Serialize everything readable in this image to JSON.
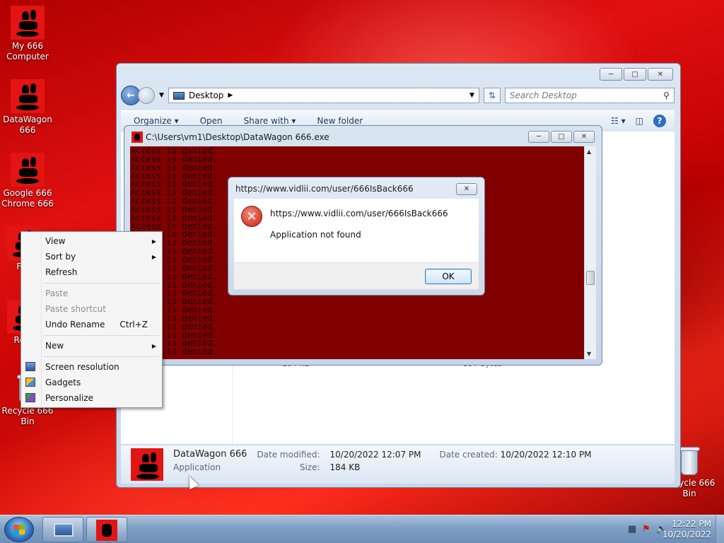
{
  "desktop": {
    "icons": [
      {
        "label": "My 666 Computer"
      },
      {
        "label": "DataWagon 666"
      },
      {
        "label": "Google 666 Chrome 666"
      },
      {
        "label": "Fire"
      },
      {
        "label": "Recy"
      },
      {
        "label": "Recycle 666 Bin"
      },
      {
        "label": "Recycle 666 Bin"
      }
    ]
  },
  "explorer": {
    "address": "Desktop",
    "search_placeholder": "Search Desktop",
    "toolbar": {
      "organize": "Organize",
      "open": "Open",
      "share_with": "Share with",
      "new_folder": "New folder"
    },
    "files": [
      {
        "size": "184 KB"
      },
      {
        "size": "397 bytes"
      }
    ],
    "details": {
      "name": "DataWagon 666",
      "type": "Application",
      "date_modified_label": "Date modified:",
      "date_modified": "10/20/2022 12:07 PM",
      "size_label": "Size:",
      "size": "184 KB",
      "date_created_label": "Date created:",
      "date_created": "10/20/2022 12:10 PM"
    }
  },
  "console": {
    "title": "C:\\Users\\vm1\\Desktop\\DataWagon 666.exe",
    "line": "Access is denied.",
    "lines": [
      "Access is denied.",
      "Access is denied.",
      "Access is denied.",
      "Access is denied.",
      "Access is denied.",
      "Access is denied.",
      "Access is denied.",
      "Access is denied.",
      "Access is denied.",
      "Access is denied.",
      "Access is denied.",
      "Access is denied.",
      "Access is denied.",
      "Access is denied.",
      "Access is denied.",
      "Access is denied.",
      "Access is denied.",
      "Access is denied.",
      "Access is denied.",
      "Access is denied.",
      "Access is denied.",
      "Access is denied.",
      "Access is denied.",
      "Access is denied.",
      "Access is denied."
    ]
  },
  "dialog": {
    "title": "https://www.vidlii.com/user/666IsBack666",
    "message_url": "https://www.vidlii.com/user/666IsBack666",
    "message": "Application not found",
    "ok": "OK"
  },
  "context_menu": {
    "view": "View",
    "sort_by": "Sort by",
    "refresh": "Refresh",
    "paste": "Paste",
    "paste_shortcut": "Paste shortcut",
    "undo_rename": "Undo Rename",
    "undo_shortcut": "Ctrl+Z",
    "new": "New",
    "screen_resolution": "Screen resolution",
    "gadgets": "Gadgets",
    "personalize": "Personalize"
  },
  "taskbar": {
    "time": "12:22 PM",
    "date": "10/20/2022"
  },
  "colors": {
    "console_bg": "#800000",
    "desktop_red": "#e01010",
    "logo_red": "#e31414"
  }
}
